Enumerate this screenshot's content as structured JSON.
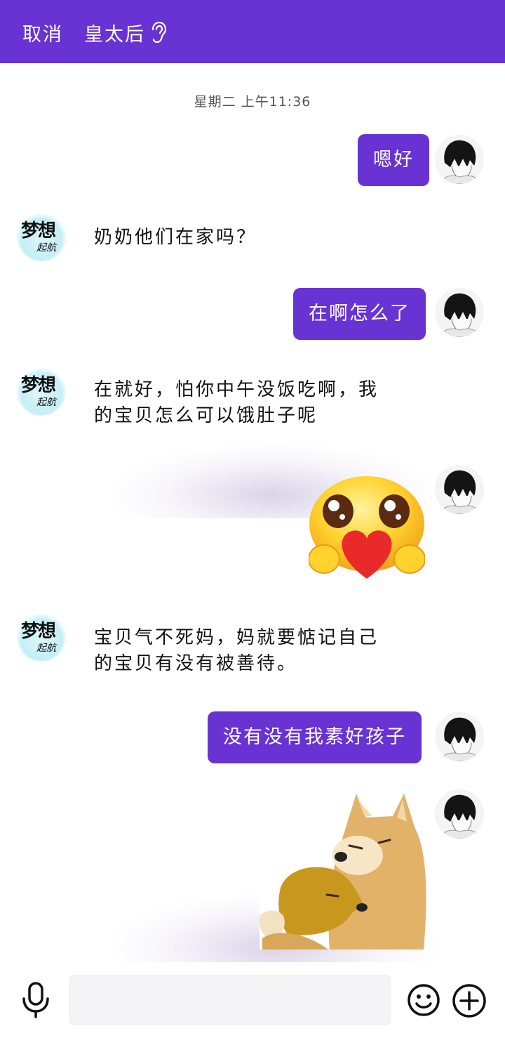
{
  "header": {
    "cancel_label": "取消",
    "contact_name": "皇太后",
    "icons": [
      "ear-icon"
    ]
  },
  "timestamp": "星期二 上午11:36",
  "messages": [
    {
      "from": "me",
      "type": "text",
      "text": "嗯好"
    },
    {
      "from": "them",
      "type": "text",
      "text": "奶奶他们在家吗？"
    },
    {
      "from": "me",
      "type": "text",
      "text": "在啊怎么了"
    },
    {
      "from": "them",
      "type": "text",
      "lines": [
        "在就好，怕你中午没饭吃啊，我",
        "的宝贝怎么可以饿肚子呢"
      ]
    },
    {
      "from": "me",
      "type": "sticker",
      "sticker": "heart-emoji-sticker"
    },
    {
      "from": "them",
      "type": "text",
      "lines": [
        "宝贝气不死妈，妈就要惦记自己",
        "的宝贝有没有被善待。"
      ]
    },
    {
      "from": "me",
      "type": "text",
      "text": "没有没有我素好孩子"
    },
    {
      "from": "me",
      "type": "sticker",
      "sticker": "doge-hug-sticker"
    }
  ],
  "avatars": {
    "them_line1": "梦想",
    "them_line2": "起航"
  },
  "input": {
    "value": "",
    "placeholder": ""
  },
  "colors": {
    "accent": "#6833d2",
    "bubble_text": "#ffffff",
    "background": "#ffffff"
  }
}
